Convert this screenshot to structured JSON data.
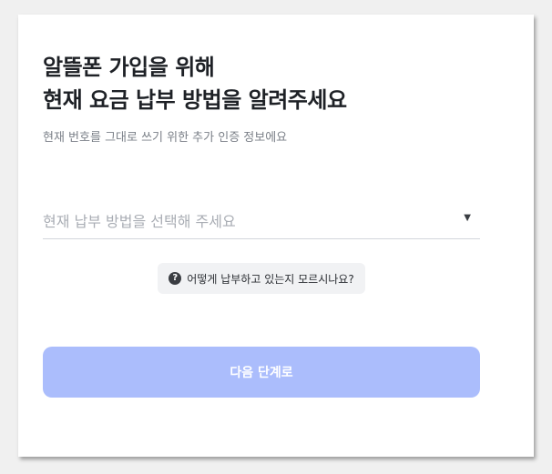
{
  "heading": {
    "line1": "알뜰폰 가입을 위해",
    "line2": "현재 요금 납부 방법을 알려주세요"
  },
  "subheading": "현재 번호를 그대로 쓰기 위한 추가 인증 정보에요",
  "payment_select": {
    "placeholder": "현재 납부 방법을 선택해 주세요",
    "caret": "▼"
  },
  "help_link": {
    "icon": "question-circle-icon",
    "icon_glyph": "?",
    "label": "어떻게 납부하고 있는지 모르시나요?"
  },
  "next_button": {
    "label": "다음 단계로",
    "color": "#abbdfc"
  }
}
